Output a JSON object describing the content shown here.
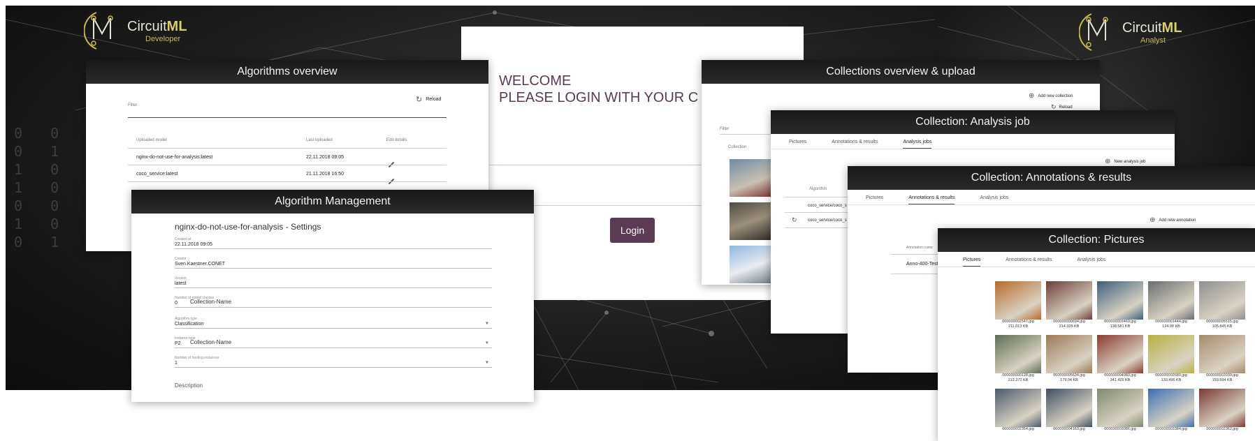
{
  "background": {
    "digits": "0 0 0 1\n0 1 0 0\n1 0 1 0\n1 0 1 1\n0 0 1 0\n1 0 1 1\n0 1 0 1"
  },
  "logo_left": {
    "name_a": "Circuit",
    "name_b": "ML",
    "sub": "Developer"
  },
  "logo_right": {
    "name_a": "Circuit",
    "name_b": "ML",
    "sub": "Analyst"
  },
  "algorithms_overview": {
    "title": "Algorithms overview",
    "reload_label": "Reload",
    "filter_label": "Filter",
    "columns": [
      "Uploaded model",
      "Last uploaded",
      "Edit details"
    ],
    "rows": [
      {
        "model": "nginx-do-not-use-for-analysis:latest",
        "date": "22.11.2018 09:05"
      },
      {
        "model": "coco_service:latest",
        "date": "21.11.2018 16:50"
      }
    ]
  },
  "login": {
    "welcome": "WELCOME",
    "prompt": "PLEASE LOGIN WITH YOUR C",
    "button": "Login"
  },
  "algorithm_management": {
    "title": "Algorithm Management",
    "heading": "nginx-do-not-use-for-analysis - Settings",
    "created_label": "Created at",
    "created_value": "22.11.2018 09:05",
    "creator_label": "Creator",
    "creator_value": "Sven.Kaestner.CONET",
    "version_label": "Version",
    "version_value": "latest",
    "number_label": "Number of model classes",
    "number_value": "0",
    "overlay_1": "Collection-Name",
    "algo_type_label": "Algorithm type",
    "algo_type_value": "Classification",
    "instance_label": "Instance type",
    "instance_value": "P2",
    "overlay_2": "Collection-Name",
    "hosting_label": "Number of hosting instances",
    "hosting_value": "1",
    "description_label": "Description"
  },
  "collections_overview": {
    "title": "Collections overview & upload",
    "add_label": "Add new collection",
    "reload_label": "Reload",
    "filter_label": "Filter",
    "collection_col": "Collection"
  },
  "analysis_job": {
    "title": "Collection: Analysis job",
    "tabs": [
      "Pictures",
      "Annotations & results",
      "Analysis jobs"
    ],
    "new_label": "New analysis job",
    "algorithm_col": "Algorithm",
    "rows": [
      "coco_service/coco_s",
      "coco_service/coco_s"
    ]
  },
  "annotations": {
    "title": "Collection: Annotations & results",
    "tabs": [
      "Pictures",
      "Annotations & results",
      "Analysis jobs"
    ],
    "add_label": "Add new annotation",
    "name_col": "Annotation name",
    "rows": [
      "Anno-400-Test"
    ]
  },
  "pictures": {
    "title": "Collection: Pictures",
    "tabs": [
      "Pictures",
      "Annotations & results",
      "Analysis jobs"
    ],
    "items": [
      {
        "name": "000000002547.jpg",
        "size": "211.013 KB",
        "color": "#b86a2a"
      },
      {
        "name": "000000000694.jpg",
        "size": "214.325 KB",
        "color": "#6b3e38"
      },
      {
        "name": "000000003469.jpg",
        "size": "138.581 KB",
        "color": "#3d5f7a"
      },
      {
        "name": "000000001444.jpg",
        "size": "124.98 KB",
        "color": "#6a6e70"
      },
      {
        "name": "000000005515.jpg",
        "size": "105.845 KB",
        "color": "#8f8f8f"
      },
      {
        "name": "000000000128.jpg",
        "size": "212.272 KB",
        "color": "#5d6e52"
      },
      {
        "name": "000000005634.jpg",
        "size": "179.04 KB",
        "color": "#9a7a55"
      },
      {
        "name": "000000004983.jpg",
        "size": "341.425 KB",
        "color": "#8a3c2e"
      },
      {
        "name": "000000002680.jpg",
        "size": "130.496 KB",
        "color": "#b5b23e"
      },
      {
        "name": "000000002039.jpg",
        "size": "159.594 KB",
        "color": "#a68a6a"
      },
      {
        "name": "000000002354.jpg",
        "size": "",
        "color": "#4a5a6b"
      },
      {
        "name": "000000004163.jpg",
        "size": "",
        "color": "#3f4f62"
      },
      {
        "name": "000000003086.jpg",
        "size": "",
        "color": "#7e8a6e"
      },
      {
        "name": "000000003384.jpg",
        "size": "",
        "color": "#3c6fb0"
      },
      {
        "name": "000000002362.jpg",
        "size": "",
        "color": "#7a3a35"
      }
    ]
  }
}
